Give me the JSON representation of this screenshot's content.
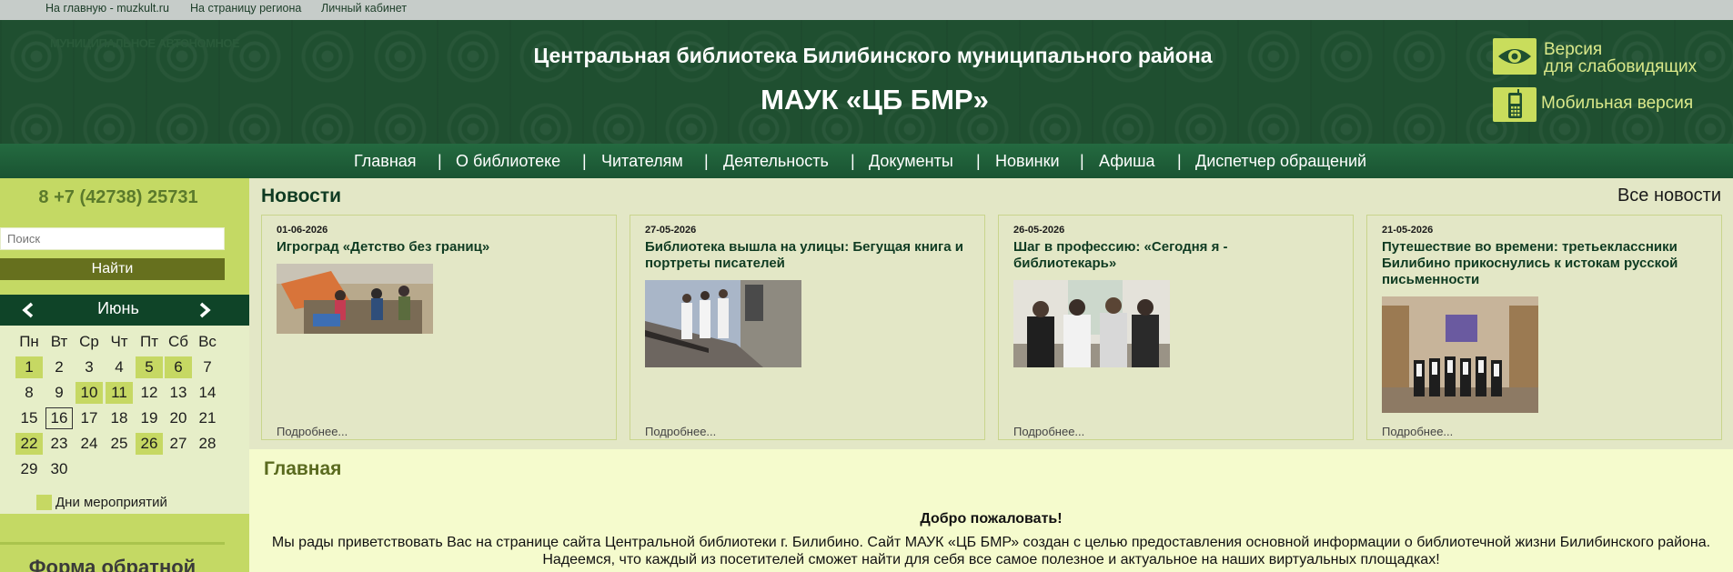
{
  "topbar": {
    "links": [
      "На главную - muzkult.ru",
      "На страницу региона",
      "Личный кабинет"
    ]
  },
  "header": {
    "logo_text": "МУНИЦИПАЛЬНОЕ АВТОНОМНОЕ",
    "title": "Центральная библиотека Билибинского муниципального района",
    "subtitle": "МАУК «ЦБ БМР»",
    "low_vision_line1": "Версия",
    "low_vision_line2": "для слабовидящих",
    "low_vision_icon": "eye-icon",
    "mobile_label": "Мобильная версия",
    "mobile_icon": "mobile-phone-icon",
    "accent_color": "#c9dd5c",
    "bg_color": "#1f4f30"
  },
  "nav": {
    "items": [
      "Главная",
      "О библиотеке",
      "Читателям",
      "Деятельность",
      "Документы",
      "Новинки",
      "Афиша",
      "Диспетчер обращений"
    ],
    "separator": "|"
  },
  "sidebar": {
    "phone": "8 +7 (42738) 25731",
    "search_placeholder": "Поиск",
    "search_button": "Найти",
    "calendar": {
      "month": "Июнь",
      "prev_icon": "chevron-left-icon",
      "next_icon": "chevron-right-icon",
      "weekdays": [
        "Пн",
        "Вт",
        "Ср",
        "Чт",
        "Пт",
        "Сб",
        "Вс"
      ],
      "days": [
        "1",
        "2",
        "3",
        "4",
        "5",
        "6",
        "7",
        "8",
        "9",
        "10",
        "11",
        "12",
        "13",
        "14",
        "15",
        "16",
        "17",
        "18",
        "19",
        "20",
        "21",
        "22",
        "23",
        "24",
        "25",
        "26",
        "27",
        "28",
        "29",
        "30"
      ],
      "event_days": [
        1,
        5,
        6,
        10,
        11,
        22,
        26
      ],
      "today": 16,
      "legend": "Дни мероприятий"
    },
    "feedback_label": "Форма обратной"
  },
  "news": {
    "title": "Новости",
    "all_link": "Все новости",
    "items": [
      {
        "date": "01-06-2026",
        "title": "Игроград «Детство без границ»",
        "more": "Подробнее..."
      },
      {
        "date": "27-05-2026",
        "title": "Библиотека вышла на улицы: Бегущая книга и портреты писателей",
        "more": "Подробнее..."
      },
      {
        "date": "26-05-2026",
        "title": "Шаг в профессию: «Сегодня я - библиотекарь»",
        "more": "Подробнее..."
      },
      {
        "date": "21-05-2026",
        "title": "Путешествие во времени: третьеклассники Билибино прикоснулись к истокам русской письменности",
        "more": "Подробнее..."
      }
    ]
  },
  "content": {
    "title": "Главная",
    "welcome": "Добро пожаловать!",
    "paragraph1": "Мы рады приветствовать Вас на странице сайта Центральной библиотеки г. Билибино. Сайт МАУК «ЦБ БМР» создан с целью предоставления основной информации о библиотечной жизни Билибинского района.",
    "paragraph2": "Надеемся, что каждый из посетителей сможет найти для себя все самое полезное и актуальное на наших виртуальных площадках!"
  }
}
